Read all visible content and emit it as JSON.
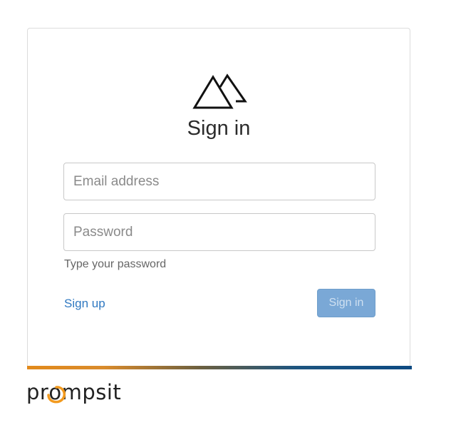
{
  "page": {
    "title": "Sign in"
  },
  "form": {
    "email_placeholder": "Email address",
    "password_placeholder": "Password",
    "password_hint": "Type your password",
    "signup_label": "Sign up",
    "signin_label": "Sign in"
  },
  "brand": {
    "prefix": "pr",
    "o": "o",
    "suffix": "mpsit",
    "logo_icon": "mountains-icon",
    "swirl_icon": "orange-swirl-icon"
  },
  "colors": {
    "link": "#2f78c1",
    "button_bg": "#7aa8d6",
    "bar_left": "#e28a1b",
    "bar_right": "#0d4a82",
    "swirl": "#f29a1f"
  }
}
